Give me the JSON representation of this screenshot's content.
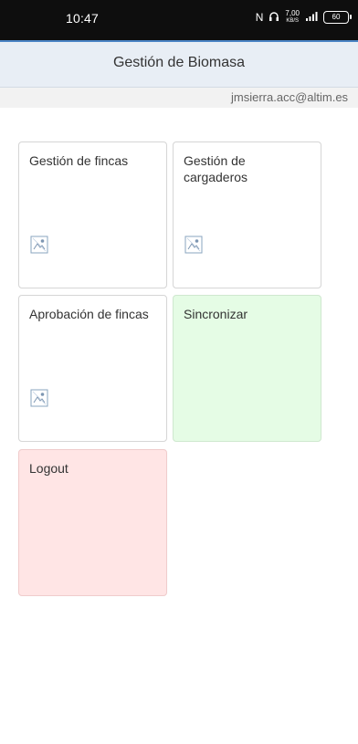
{
  "status_bar": {
    "time": "10:47",
    "network_speed": "7,00",
    "network_speed_unit": "KB/S",
    "battery": "60",
    "icons": [
      "nfc-icon",
      "headphones-icon",
      "signal-icon",
      "battery-icon"
    ]
  },
  "header": {
    "title": "Gestión de Biomasa"
  },
  "user": {
    "email": "jmsierra.acc@altim.es"
  },
  "tiles": [
    {
      "title": "Gestión de fincas",
      "icon": "image-placeholder-icon"
    },
    {
      "title": "Gestión de cargaderos",
      "icon": "image-placeholder-icon"
    },
    {
      "title": "Aprobación de fincas",
      "icon": "image-placeholder-icon"
    },
    {
      "title": "Sincronizar",
      "color": "#e5fce5"
    },
    {
      "title": "Logout",
      "color": "#ffe5e5"
    }
  ],
  "colors": {
    "header_background": "#e8eef5",
    "header_accent": "#4a84c5",
    "sync_tile": "#e5fce5",
    "logout_tile": "#ffe5e5"
  }
}
